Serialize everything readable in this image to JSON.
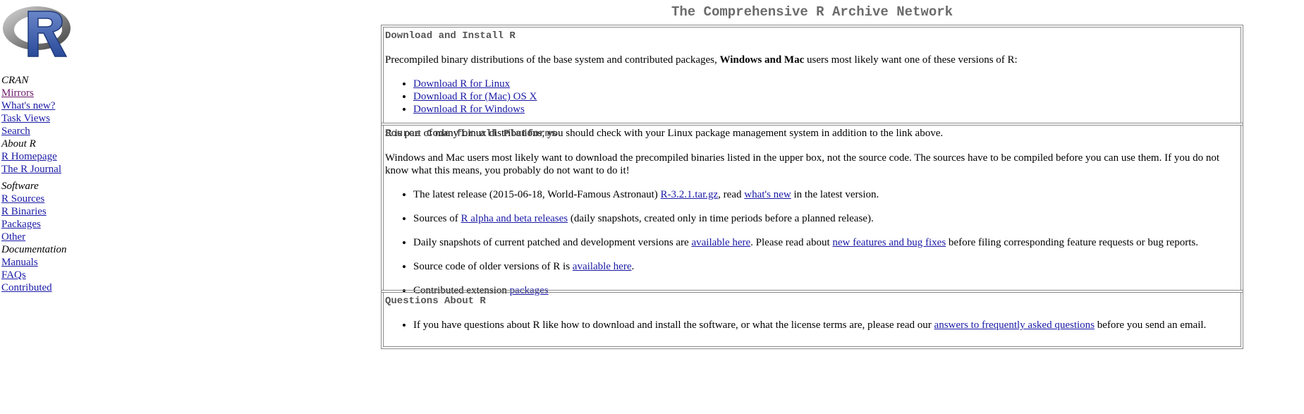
{
  "logo": {
    "letter": "R",
    "alt": "R"
  },
  "nav": {
    "cran": {
      "title": "CRAN",
      "links": [
        "Mirrors",
        "What's new?",
        "Task Views",
        "Search"
      ]
    },
    "about": {
      "title": "About R",
      "links": [
        "R Homepage",
        "The R Journal"
      ]
    },
    "software": {
      "title": "Software",
      "links": [
        "R Sources",
        "R Binaries",
        "Packages",
        "Other"
      ]
    },
    "documentation": {
      "title": "Documentation",
      "links": [
        "Manuals",
        "FAQs",
        "Contributed"
      ]
    }
  },
  "main": {
    "title": "The Comprehensive R Archive Network",
    "download": {
      "heading": "Download and Install R",
      "intro_1": "Precompiled binary distributions of the base system and contributed packages,",
      "intro_bold": "Windows and Mac",
      "intro_2": "users most likely want one of these versions of R:",
      "links": [
        "Download R for Linux",
        "Download R for (Mac) OS X",
        "Download R for Windows"
      ],
      "footer": "R is part of many Linux distributions, you should check with your Linux package management system in addition to the link above."
    },
    "source": {
      "heading": "Source Code for all Platforms",
      "intro": "Windows and Mac users most likely want to download the precompiled binaries listed in the upper box, not the source code. The sources have to be compiled before you can use them. If you do not know what this means, you probably do not want to do it!",
      "item1_a": "The latest release (2015-06-18, World-Famous Astronaut)",
      "item1_link1": "R-3.2.1.tar.gz",
      "item1_b": ", read",
      "item1_link2": "what's new",
      "item1_c": "in the latest version.",
      "item2_a": "Sources of",
      "item2_link": "R alpha and beta releases",
      "item2_b": "(daily snapshots, created only in time periods before a planned release).",
      "item3_a": "Daily snapshots of current patched and development versions are",
      "item3_link1": "available here",
      "item3_b": ". Please read about",
      "item3_link2": "new features and bug fixes",
      "item3_c": "before filing corresponding feature requests or bug reports.",
      "item4_a": "Source code of older versions of R is",
      "item4_link": "available here",
      "item4_b": ".",
      "item5_a": "Contributed extension",
      "item5_link": "packages"
    },
    "questions": {
      "heading": "Questions About R",
      "item_a": "If you have questions about R like how to download and install the software, or what the license terms are, please read our",
      "item_link": "answers to frequently asked questions",
      "item_b": "before you send an email."
    }
  }
}
